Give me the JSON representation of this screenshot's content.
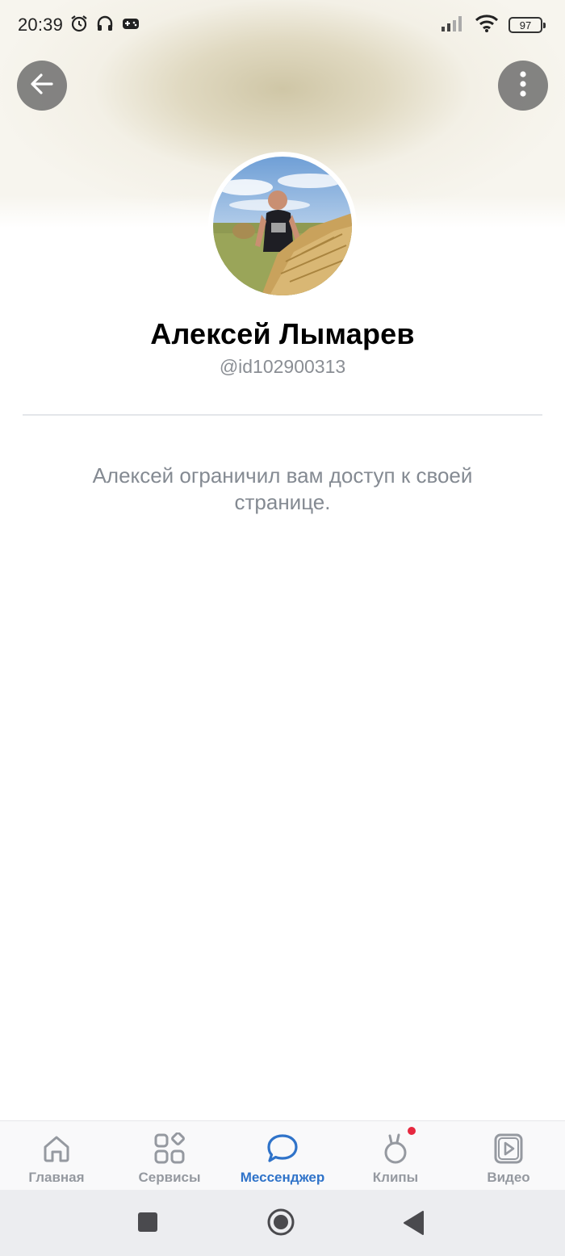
{
  "status_bar": {
    "time": "20:39",
    "battery": "97",
    "icons_left": [
      "alarm-icon",
      "headphones-icon",
      "gamepad-icon"
    ],
    "icons_right": [
      "signal-icon",
      "wifi-icon",
      "battery-icon"
    ]
  },
  "header": {
    "back_icon": "arrow-left-icon",
    "more_icon": "more-vertical-icon"
  },
  "profile": {
    "name": "Алексей Лымарев",
    "handle": "@id102900313",
    "restricted_message": "Алексей ограничил вам доступ к своей странице."
  },
  "tab_bar": {
    "active": "Мессенджер",
    "accent_color": "#2f73c9",
    "tabs": [
      {
        "label": "Главная",
        "icon": "home-icon"
      },
      {
        "label": "Сервисы",
        "icon": "services-icon"
      },
      {
        "label": "Мессенджер",
        "icon": "messenger-icon"
      },
      {
        "label": "Клипы",
        "icon": "clips-icon"
      },
      {
        "label": "Видео",
        "icon": "video-icon"
      }
    ]
  },
  "system_nav": {
    "buttons": [
      "recent-apps-icon",
      "home-icon",
      "back-triangle-icon"
    ]
  }
}
